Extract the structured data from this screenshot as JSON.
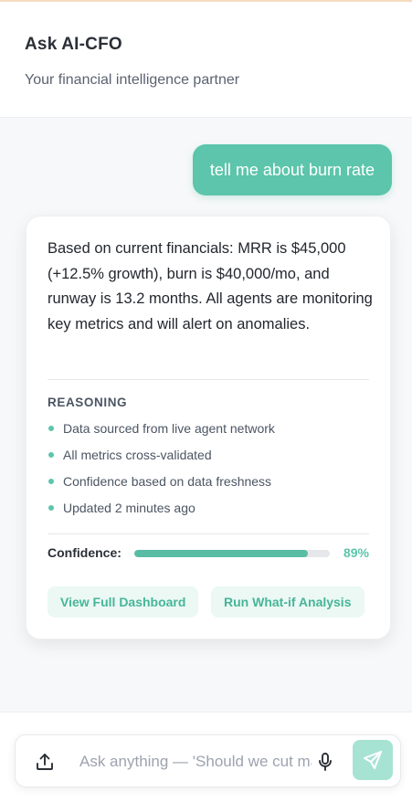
{
  "header": {
    "title": "Ask AI-CFO",
    "subtitle": "Your financial intelligence partner"
  },
  "chat": {
    "user_message": "tell me about burn rate",
    "ai_response": {
      "text": "Based on current financials: MRR is $45,000 (+12.5% growth), burn is $40,000/mo, and runway is 13.2 months. All agents are monitoring key metrics and will alert on anomalies.",
      "reasoning_title": "REASONING",
      "reasoning_items": [
        "Data sourced from live agent network",
        "All metrics cross-validated",
        "Confidence based on data freshness",
        "Updated 2 minutes ago"
      ],
      "confidence": {
        "label": "Confidence:",
        "value_text": "89%",
        "value": 0.89
      },
      "actions": {
        "view_dashboard": "View Full Dashboard",
        "what_if": "Run What-if Analysis"
      }
    }
  },
  "composer": {
    "placeholder": "Ask anything — 'Should we cut marketing spend?'",
    "icons": {
      "upload": "upload-icon",
      "mic": "microphone-icon",
      "send": "send-icon"
    }
  },
  "colors": {
    "accent": "#5cc5ab",
    "accent_light": "#ebf8f4",
    "send_button": "#a7e3d3"
  }
}
